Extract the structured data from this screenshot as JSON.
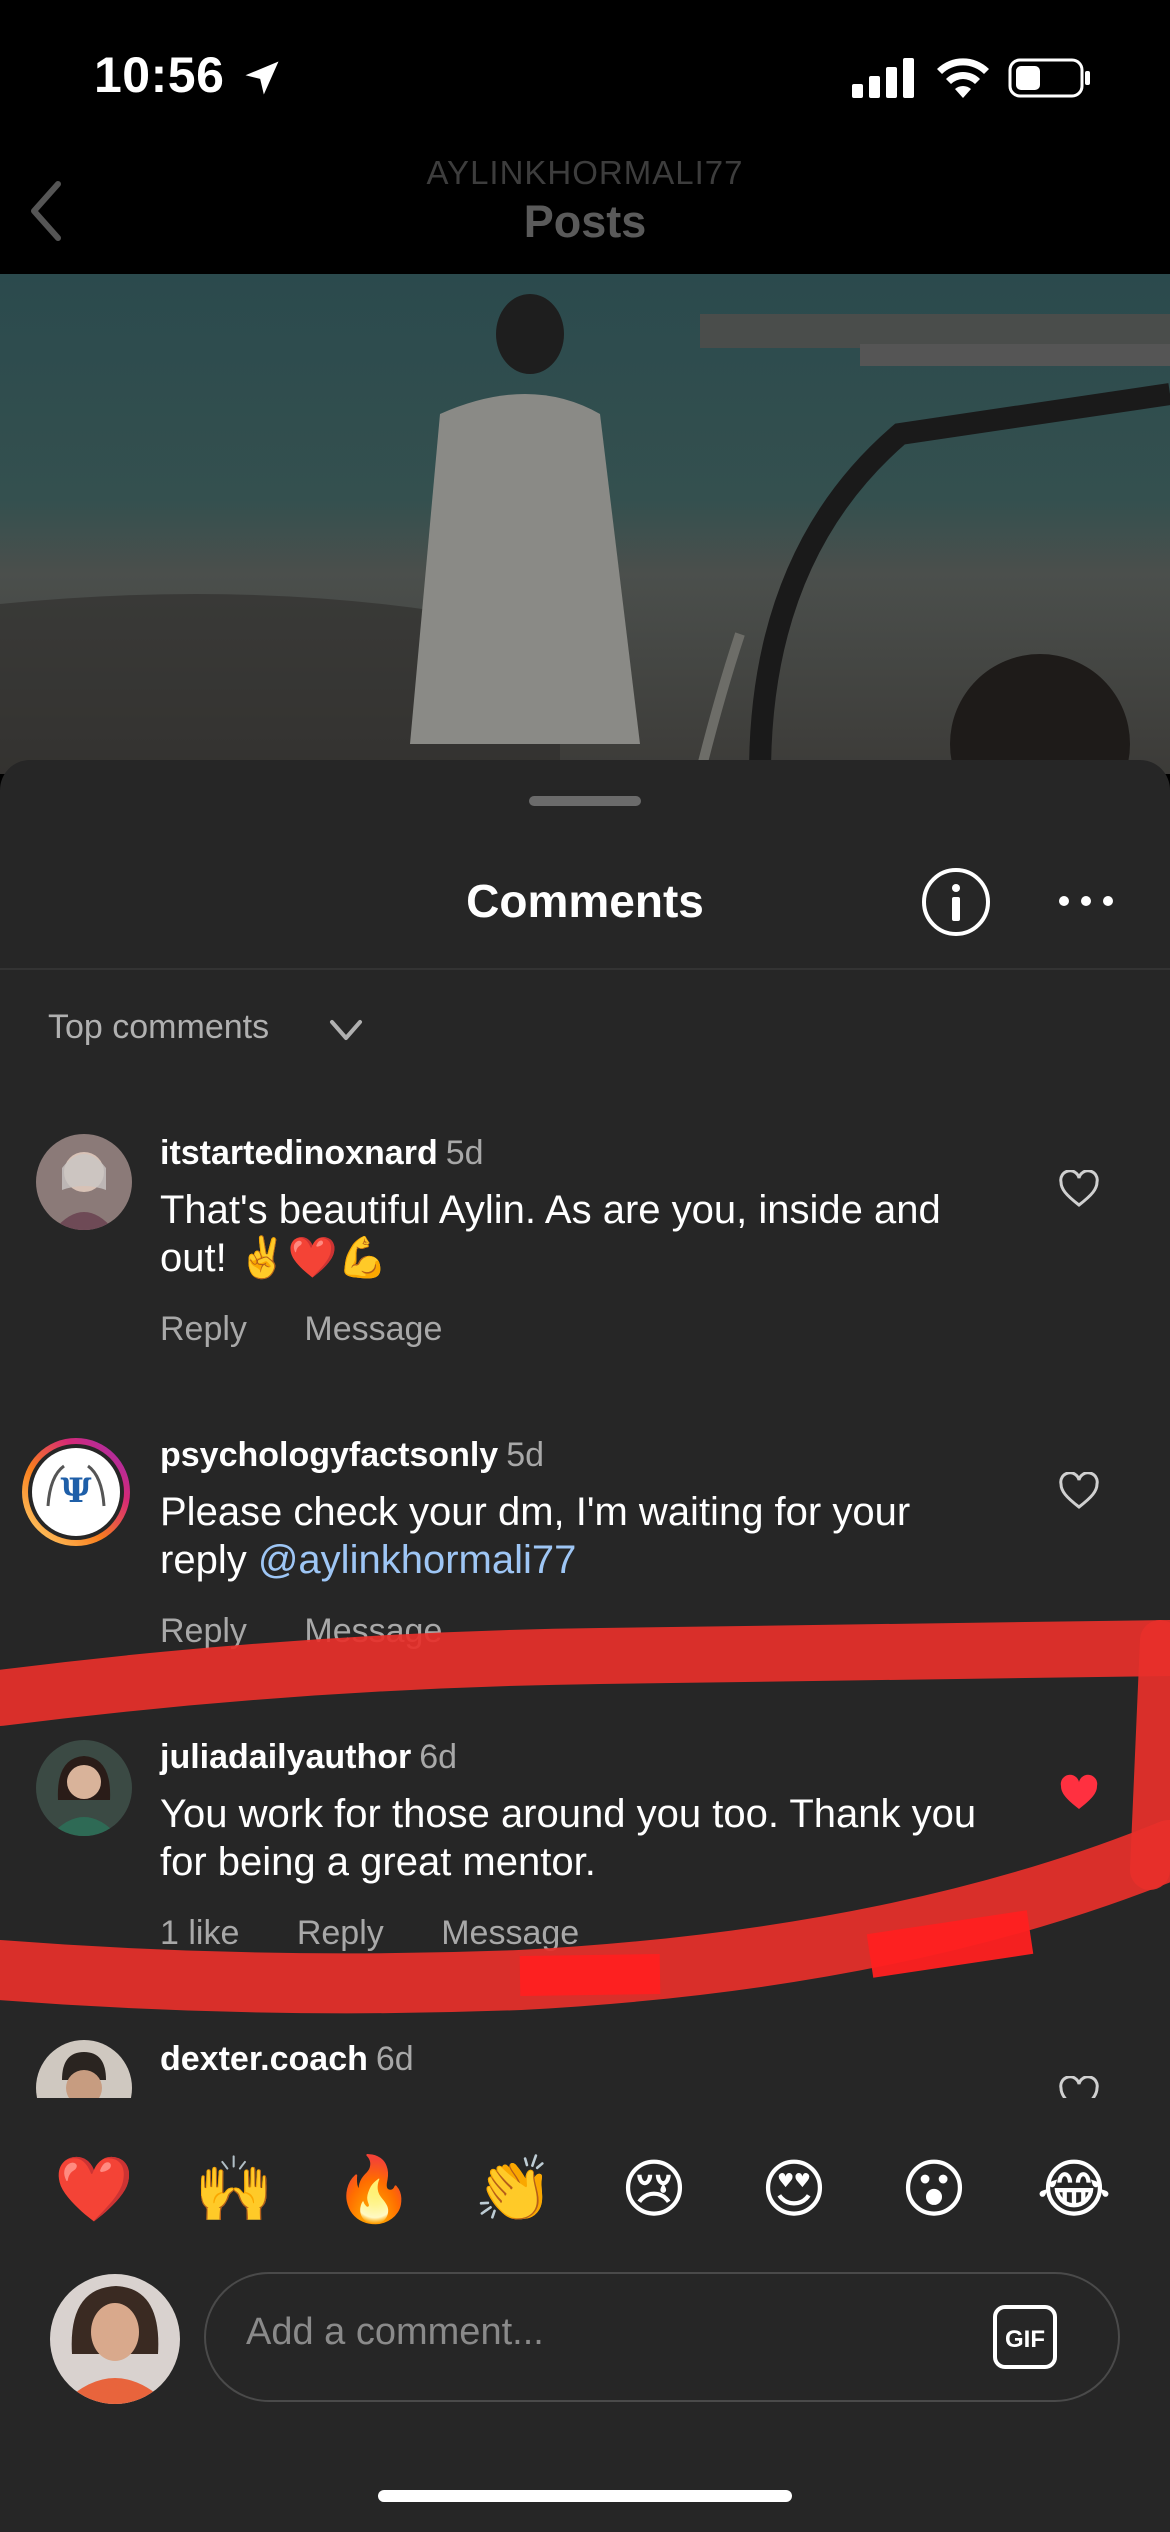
{
  "status_bar": {
    "time": "10:56"
  },
  "header": {
    "username": "AYLINKHORMALI77",
    "title": "Posts"
  },
  "comments_sheet": {
    "title": "Comments",
    "sort_label": "Top comments",
    "comments": [
      {
        "username": "itstartedinoxnard",
        "ago": "5d",
        "text": "That's beautiful Aylin. As are you, inside and out! ✌️❤️💪",
        "reply_label": "Reply",
        "message_label": "Message",
        "liked": false
      },
      {
        "username": "psychologyfactsonly",
        "ago": "5d",
        "text": "Please check your dm, I'm waiting for your reply",
        "mention": "@aylinkhormali77",
        "reply_label": "Reply",
        "message_label": "Message",
        "liked": false
      },
      {
        "username": "juliadailyauthor",
        "ago": "6d",
        "text": "You work for those around you too. Thank you for being a great mentor.",
        "likes_label": "1 like",
        "reply_label": "Reply",
        "message_label": "Message",
        "liked": true
      },
      {
        "username": "dexter.coach",
        "ago": "6d",
        "liked": false
      }
    ]
  },
  "quick_reactions": [
    "❤️",
    "🙌",
    "🔥",
    "👏",
    "😢",
    "😍",
    "😮",
    "😂"
  ],
  "composer": {
    "placeholder": "Add a comment...",
    "gif_label": "GIF"
  },
  "colors": {
    "sheet_bg": "#262626",
    "liked_heart": "#ff3040",
    "mention": "#9ec6f5",
    "annotation_scribble": "#e8302a"
  },
  "icons": [
    "location-arrow-icon",
    "signal-icon",
    "wifi-icon",
    "battery-icon",
    "back-chevron-icon",
    "info-icon",
    "more-icon",
    "chevron-down-icon",
    "heart-icon",
    "gif-icon"
  ]
}
